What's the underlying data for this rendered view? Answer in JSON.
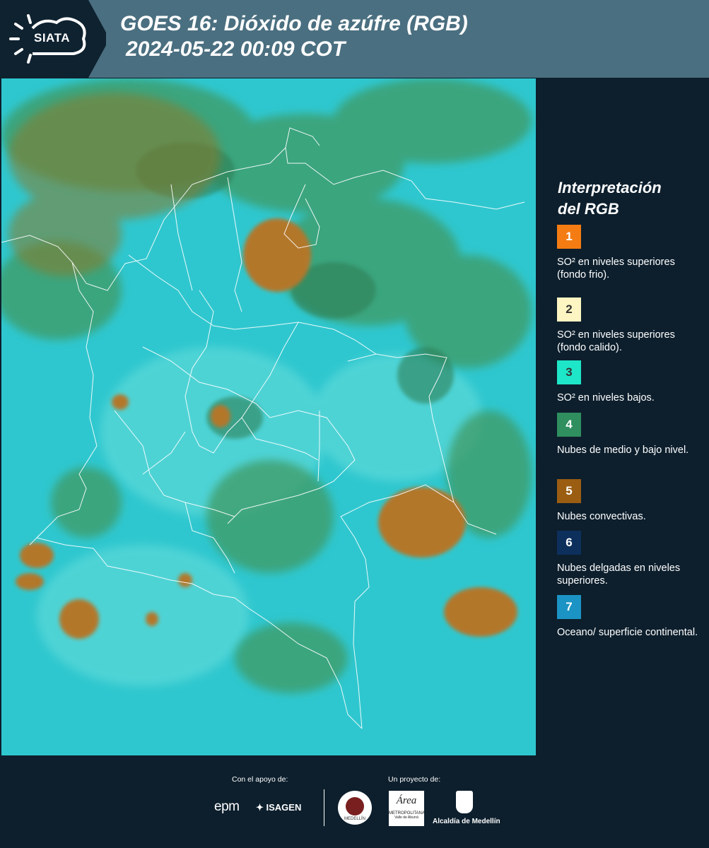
{
  "header": {
    "logo_text": "SIATA",
    "title_line1": "GOES 16: Dióxido de azúfre (RGB)",
    "title_line2": "2024-05-22 00:09 COT"
  },
  "legend": {
    "title_line1": "Interpretación",
    "title_line2": "del RGB",
    "items": [
      {
        "number": "1",
        "color": "#f47c13",
        "text_color": "#ffffff",
        "description": "SO² en niveles superiores (fondo frio)."
      },
      {
        "number": "2",
        "color": "#fdf5c2",
        "text_color": "#333333",
        "description": "SO² en niveles superiores (fondo calido)."
      },
      {
        "number": "3",
        "color": "#1ee6c8",
        "text_color": "#333333",
        "description": "SO² en niveles bajos."
      },
      {
        "number": "4",
        "color": "#2f8f5f",
        "text_color": "#ffffff",
        "description": "Nubes de medio y bajo nivel."
      },
      {
        "number": "5",
        "color": "#9a5d12",
        "text_color": "#ffffff",
        "description": "Nubes convectivas."
      },
      {
        "number": "6",
        "color": "#0d2f5c",
        "text_color": "#ffffff",
        "description": "Nubes delgadas en niveles superiores."
      },
      {
        "number": "7",
        "color": "#1b93c4",
        "text_color": "#ffffff",
        "description": "Oceano/ superficie continental."
      }
    ]
  },
  "footer": {
    "support_label": "Con el apoyo de:",
    "project_label": "Un proyecto de:",
    "sponsor_1": "epm",
    "sponsor_2": "ISAGEN",
    "partner_1": "MEDELLÍN",
    "partner_2_line1": "Área",
    "partner_2_line2": "METROPOLITANA",
    "partner_2_line3": "Valle de Aburrá",
    "partner_3": "Alcaldía de Medellín"
  },
  "map": {
    "ocean_color": "#2fc7cf",
    "cloud_color_low": "#3f9a63",
    "cloud_color_convective": "#b3772a",
    "border_color": "#ffffff"
  }
}
